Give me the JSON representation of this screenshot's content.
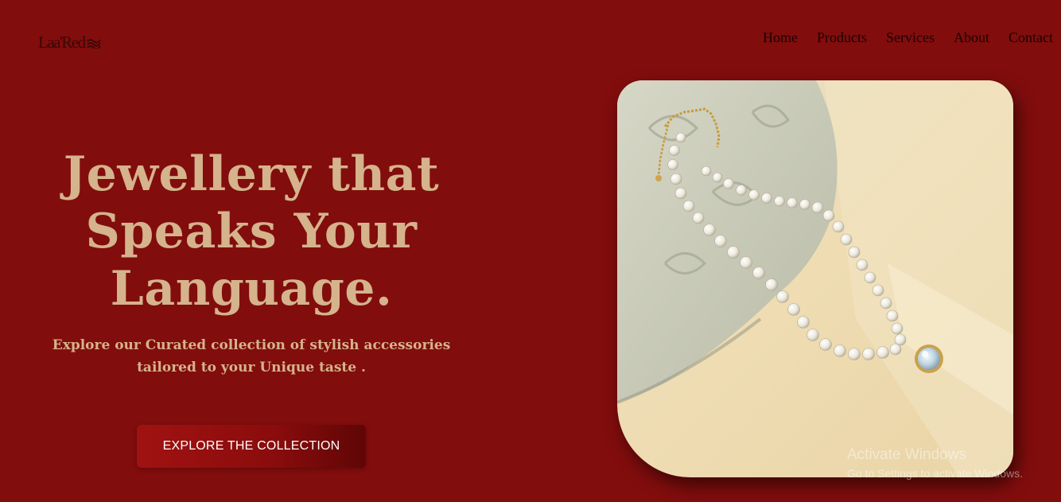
{
  "brand": {
    "name": "Laa'Red"
  },
  "nav": {
    "items": [
      "Home",
      "Products",
      "Services",
      "About",
      "Contact"
    ]
  },
  "hero": {
    "title_lines": [
      "Jewellery that",
      "Speaks Your",
      "Language."
    ],
    "subtitle_lines": [
      "Explore our Curated collection of stylish accessories",
      "tailored to your Unique taste ."
    ],
    "cta_label": "EXPLORE THE COLLECTION",
    "image": {
      "icon": "pearl-necklace-photo"
    }
  },
  "watermark": {
    "title": "Activate Windows",
    "subtitle": "Go to Settings to activate Windows."
  },
  "colors": {
    "background": "#820d0d",
    "accent_text": "#d5b38c",
    "nav_text": "#1a0303",
    "button": "#8a0c0c",
    "button_text": "#ffffff"
  }
}
